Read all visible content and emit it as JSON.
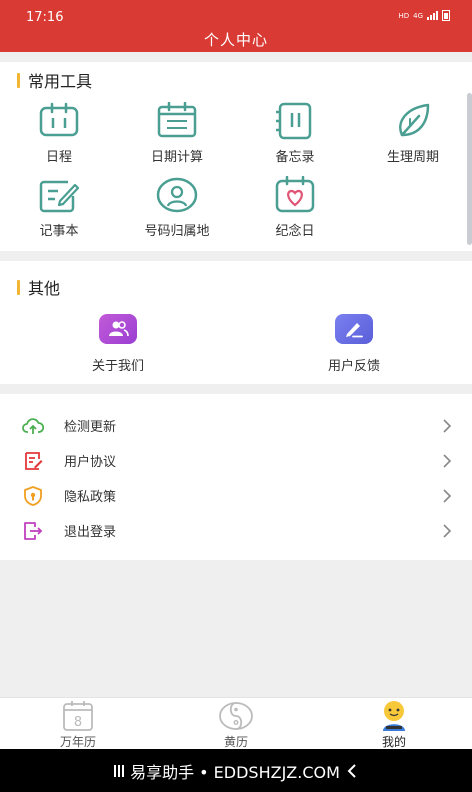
{
  "status": {
    "time": "17:16",
    "network": "HD",
    "signal": "4G"
  },
  "header": {
    "title": "个人中心"
  },
  "tools": {
    "title": "常用工具",
    "items": [
      {
        "label": "日程",
        "icon": "schedule-icon"
      },
      {
        "label": "日期计算",
        "icon": "calendar-calc-icon"
      },
      {
        "label": "备忘录",
        "icon": "memo-icon"
      },
      {
        "label": "生理周期",
        "icon": "leaf-icon"
      },
      {
        "label": "记事本",
        "icon": "notepad-icon"
      },
      {
        "label": "号码归属地",
        "icon": "phone-location-icon"
      },
      {
        "label": "纪念日",
        "icon": "heart-calendar-icon"
      }
    ]
  },
  "other": {
    "title": "其他",
    "items": [
      {
        "label": "关于我们",
        "icon": "users-icon",
        "color": "#b04fd6"
      },
      {
        "label": "用户反馈",
        "icon": "edit-icon",
        "color": "#6a6fe0"
      }
    ]
  },
  "settings": [
    {
      "label": "检测更新",
      "icon": "cloud-upload-icon",
      "color": "#4caf50"
    },
    {
      "label": "用户协议",
      "icon": "agreement-icon",
      "color": "#e4393c"
    },
    {
      "label": "隐私政策",
      "icon": "shield-icon",
      "color": "#f0a020"
    },
    {
      "label": "退出登录",
      "icon": "logout-icon",
      "color": "#c040c0"
    }
  ],
  "tabs": [
    {
      "label": "万年历",
      "icon": "calendar-8-icon",
      "date_number": "8"
    },
    {
      "label": "黄历",
      "icon": "yin-yang-icon"
    },
    {
      "label": "我的",
      "icon": "avatar-icon"
    }
  ],
  "bottom_bar": {
    "text": "易享助手 • EDDSHZJZ.COM"
  },
  "colors": {
    "accent_red": "#d93a34",
    "tool_icon": "#4a9e92",
    "section_bar": "#f2b632"
  }
}
